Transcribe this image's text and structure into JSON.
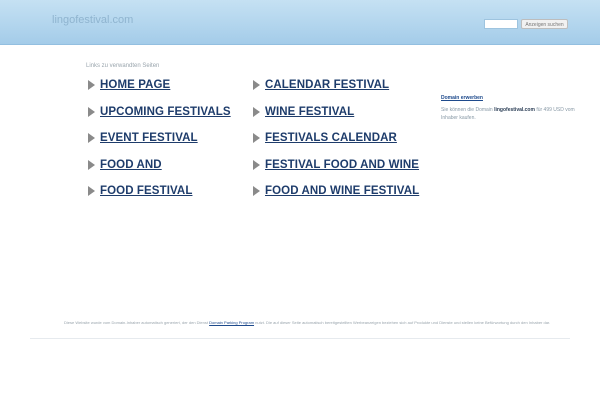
{
  "header": {
    "domain": "lingofestival.com",
    "search_placeholder": "",
    "search_button": "Anzeigen suchen"
  },
  "links_heading": "Links zu verwandten Seiten",
  "links": [
    {
      "label": "HOME PAGE"
    },
    {
      "label": "UPCOMING FESTIVALS"
    },
    {
      "label": "EVENT FESTIVAL"
    },
    {
      "label": "FOOD AND"
    },
    {
      "label": "FOOD FESTIVAL"
    },
    {
      "label": "CALENDAR FESTIVAL"
    },
    {
      "label": "WINE FESTIVAL"
    },
    {
      "label": "FESTIVALS CALENDAR"
    },
    {
      "label": "FESTIVAL FOOD AND WINE"
    },
    {
      "label": "FOOD AND WINE FESTIVAL"
    }
  ],
  "sidebar": {
    "title": "Domain erwerben",
    "text_before": "Sie können die Domain",
    "domain": "lingofestival.com",
    "text_after": "für 499 USD vom Inhaber kaufen."
  },
  "footer": {
    "text_before": "Diese Website wurde vom Domain-Inhaber automatisch generiert, der den Dienst",
    "link": "Domain Parking Program",
    "text_after": "nutzt. Die auf dieser Seite automatisch bereitgestellten Werbeanzeigen beziehen sich auf Produkte und Dienste und stellen keine Befürwortung durch den Inhaber dar."
  },
  "colors": {
    "header_top": "#c5e1f3",
    "header_bottom": "#a4cce9",
    "link": "#1e3c6b",
    "arrow": "#8a8a8a"
  },
  "icons": {
    "link_arrow": "triangle-right-icon"
  }
}
